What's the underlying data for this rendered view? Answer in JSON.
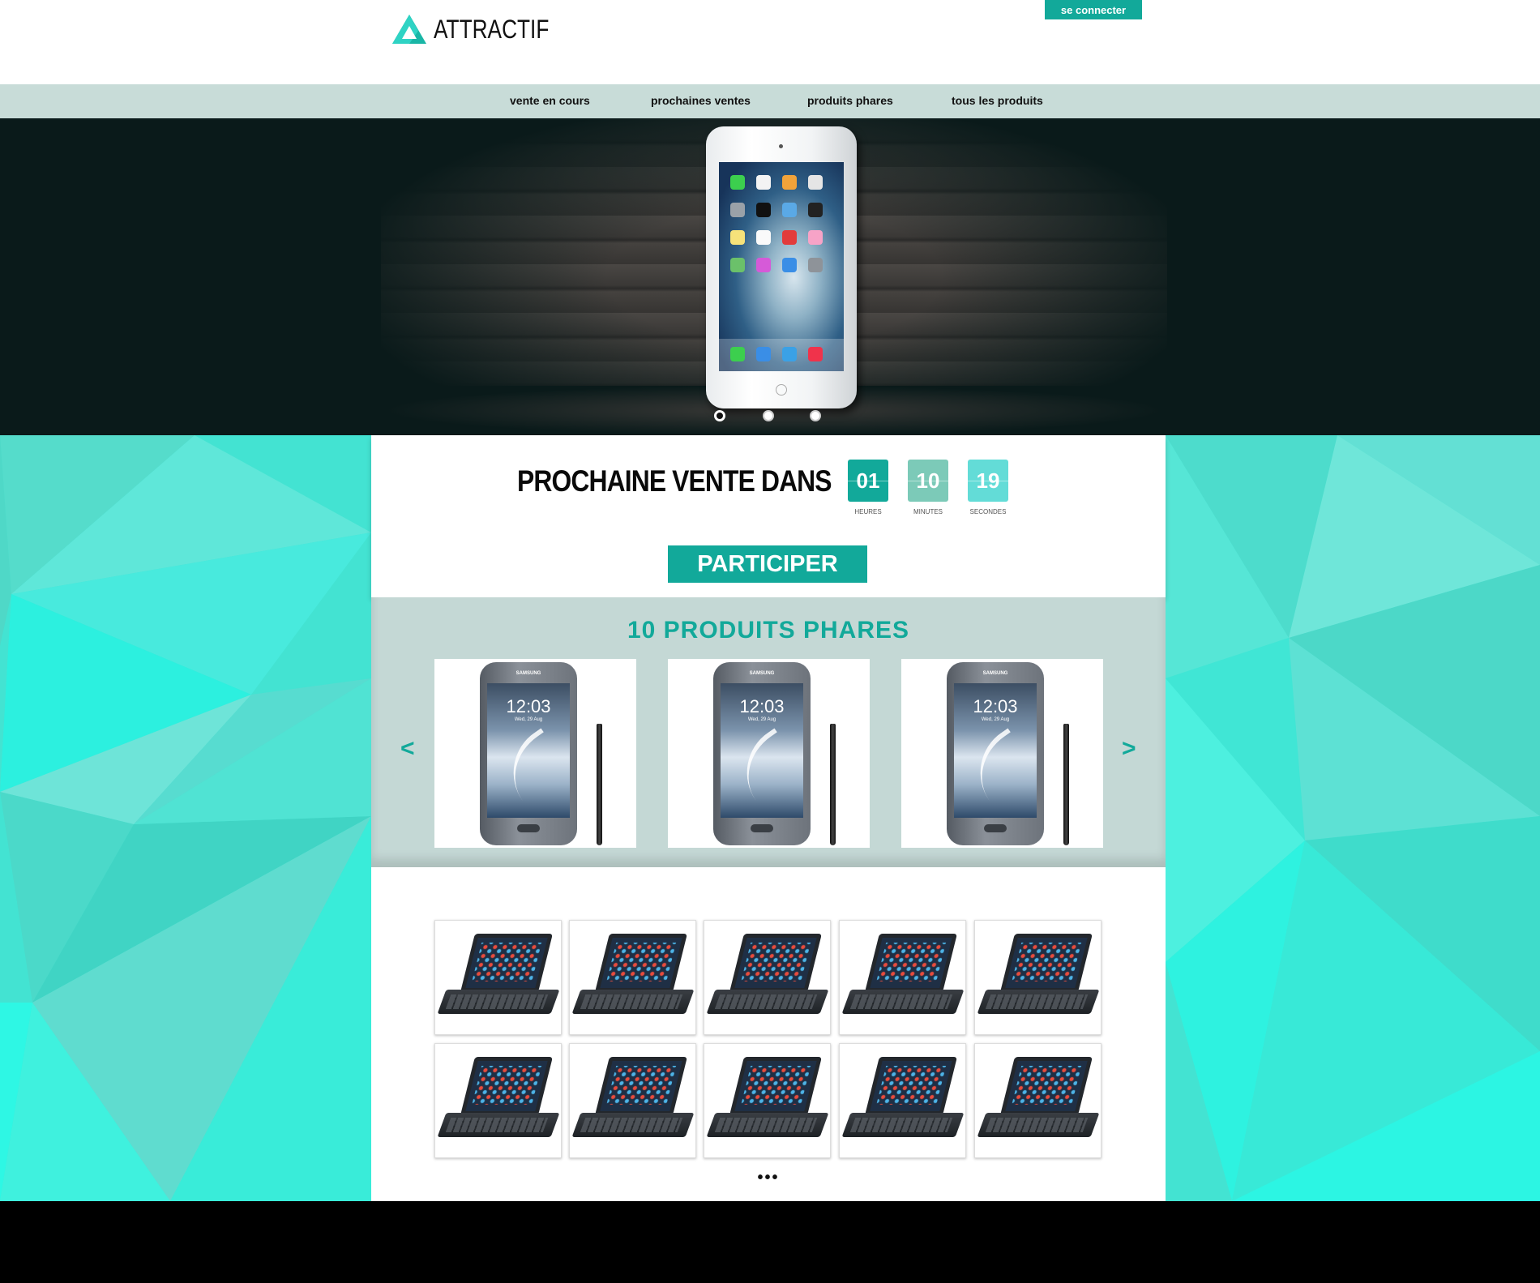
{
  "header": {
    "logo_text": "ATTRACTIF",
    "login_label": "se connecter"
  },
  "nav": {
    "items": [
      {
        "label": "vente en cours"
      },
      {
        "label": "prochaines ventes"
      },
      {
        "label": "produits phares"
      },
      {
        "label": "tous les produits"
      }
    ]
  },
  "hero": {
    "slides_count": 3,
    "active_slide": 1
  },
  "countdown": {
    "title": "PROCHAINE VENTE DANS",
    "units": [
      {
        "value": "01",
        "label": "HEURES",
        "color": "#12a99a"
      },
      {
        "value": "10",
        "label": "MINUTES",
        "color": "#7ccab8"
      },
      {
        "value": "19",
        "label": "SECONDES",
        "color": "#63dcd7"
      }
    ],
    "cta_label": "PARTICIPER"
  },
  "featured": {
    "title": "10 PRODUITS PHARES",
    "prev_label": "<",
    "next_label": ">",
    "products": [
      {
        "brand": "SAMSUNG",
        "time": "12:03",
        "date": "Wed, 29 Aug"
      },
      {
        "brand": "SAMSUNG",
        "time": "12:03",
        "date": "Wed, 29 Aug"
      },
      {
        "brand": "SAMSUNG",
        "time": "12:03",
        "date": "Wed, 29 Aug"
      }
    ]
  },
  "catalog": {
    "item_count": 10,
    "more_label": "•••"
  },
  "colors": {
    "accent": "#12a99a",
    "nav_bg": "#c8dcd8",
    "featured_bg": "#c4d8d5",
    "bg_turquoise": "#3ef2e0"
  }
}
